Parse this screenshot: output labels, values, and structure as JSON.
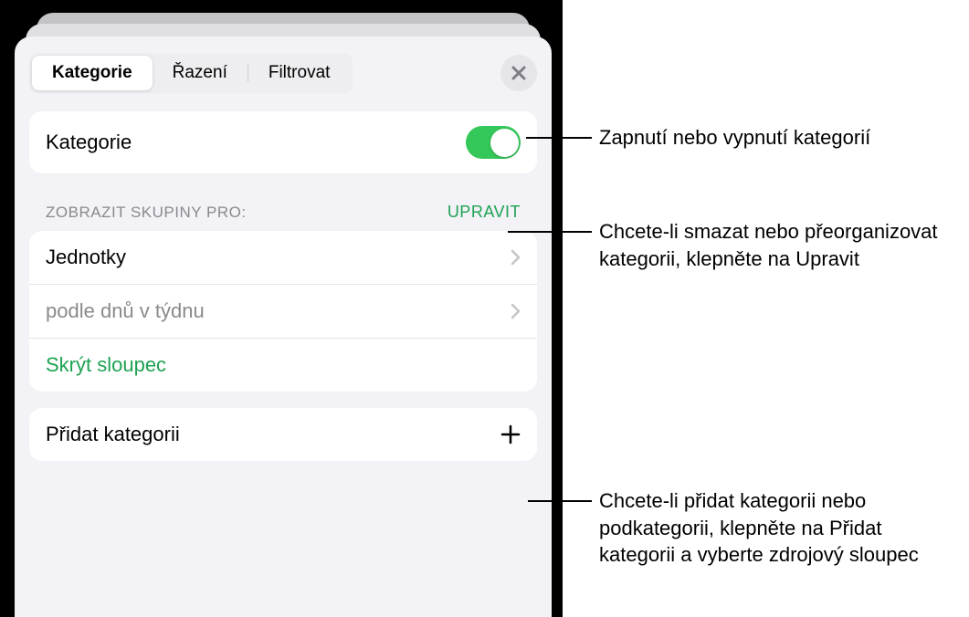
{
  "segmented": {
    "tab1": "Kategorie",
    "tab2": "Řazení",
    "tab3": "Filtrovat"
  },
  "toggleCard": {
    "label": "Kategorie"
  },
  "groupsSection": {
    "header": "ZOBRAZIT SKUPINY PRO:",
    "editLabel": "UPRAVIT",
    "row1": "Jednotky",
    "row2_prefix": "podle ",
    "row2_main": "dnů v týdnu",
    "row3": "Skrýt sloupec"
  },
  "addCard": {
    "label": "Přidat kategorii"
  },
  "annotations": {
    "a1": "Zapnutí nebo vypnutí kategorií",
    "a2": "Chcete-li smazat nebo přeorganizovat kategorii, klepněte na Upravit",
    "a3": "Chcete-li přidat kategorii nebo podkategorii, klepněte na Přidat kategorii a vyberte zdrojový sloupec"
  }
}
